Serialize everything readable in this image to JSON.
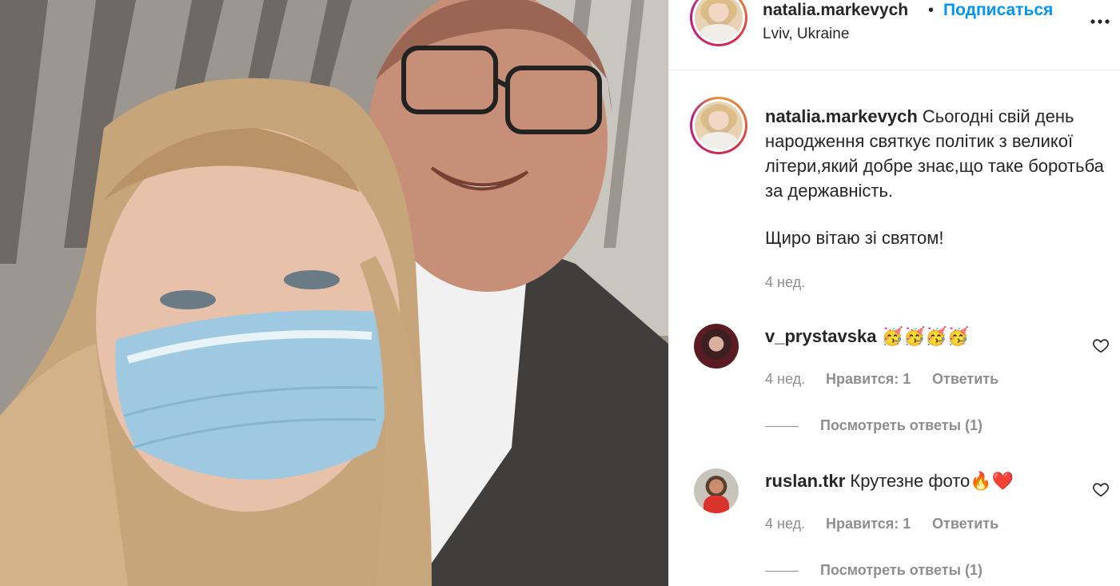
{
  "post": {
    "username": "natalia.markevych",
    "follow_separator": "•",
    "follow_label": "Подписаться",
    "location": "Lviv, Ukraine"
  },
  "caption": {
    "username": "natalia.markevych",
    "text": "Сьогодні свій день народження святкує політик з великої літери,який добре знає,що таке боротьба за державність.",
    "text2": "Щиро вітаю зі святом!",
    "time": "4 нед."
  },
  "comments": [
    {
      "username": "v_prystavska",
      "text": "🥳🥳🥳🥳",
      "time": "4 нед.",
      "likes": "Нравится: 1",
      "reply": "Ответить",
      "view_replies": "Посмотреть ответы (1)"
    },
    {
      "username": "ruslan.tkr",
      "text": "Крутезне фото🔥❤️",
      "time": "4 нед.",
      "likes": "Нравится: 1",
      "reply": "Ответить",
      "view_replies": "Посмотреть ответы (1)"
    }
  ],
  "colors": {
    "text": "#262626",
    "secondary": "#8e8e8e",
    "link": "#0095f6",
    "divider": "#efefef"
  },
  "icons": {
    "more": "more-options-icon",
    "like": "heart-outline-icon"
  }
}
